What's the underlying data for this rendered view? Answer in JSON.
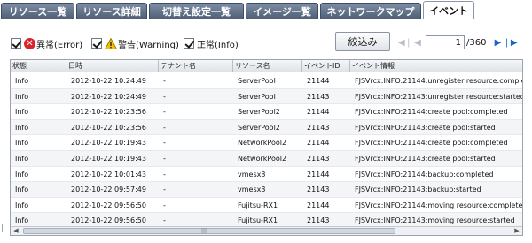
{
  "tabs": [
    {
      "label": "リソース一覧"
    },
    {
      "label": "リソース詳細"
    },
    {
      "label": "切替え設定一覧"
    },
    {
      "label": "イメージ一覧"
    },
    {
      "label": "ネットワークマップ"
    },
    {
      "label": "イベント"
    }
  ],
  "filters": {
    "error": {
      "label": "異常(Error)",
      "checked": true,
      "icon": "error-circle-icon",
      "color": "#d8242a"
    },
    "warning": {
      "label": "警告(Warning)",
      "checked": true,
      "icon": "warning-triangle-icon",
      "color": "#f2c200"
    },
    "info": {
      "label": "正常(Info)",
      "checked": true
    }
  },
  "filter_button": {
    "label": "絞込み"
  },
  "pager": {
    "current_page": "1",
    "total_pages": "/360"
  },
  "table": {
    "columns": [
      "状態",
      "日時",
      "テナント名",
      "リソース名",
      "イベントID",
      "イベント情報"
    ],
    "rows": [
      [
        "Info",
        "2012-10-22 10:24:49",
        "-",
        "ServerPool",
        "21144",
        "FJSVrcx:INFO:21144:unregister resource:completed"
      ],
      [
        "Info",
        "2012-10-22 10:24:49",
        "-",
        "ServerPool",
        "21143",
        "FJSVrcx:INFO:21143:unregister resource:started"
      ],
      [
        "Info",
        "2012-10-22 10:23:56",
        "-",
        "ServerPool2",
        "21144",
        "FJSVrcx:INFO:21144:create pool:completed"
      ],
      [
        "Info",
        "2012-10-22 10:23:56",
        "-",
        "ServerPool2",
        "21143",
        "FJSVrcx:INFO:21143:create pool:started"
      ],
      [
        "Info",
        "2012-10-22 10:19:43",
        "-",
        "NetworkPool2",
        "21144",
        "FJSVrcx:INFO:21144:create pool:completed"
      ],
      [
        "Info",
        "2012-10-22 10:19:43",
        "-",
        "NetworkPool2",
        "21143",
        "FJSVrcx:INFO:21143:create pool:started"
      ],
      [
        "Info",
        "2012-10-22 10:01:43",
        "-",
        "vmesx3",
        "21144",
        "FJSVrcx:INFO:21144:backup:completed"
      ],
      [
        "Info",
        "2012-10-22 09:57:49",
        "-",
        "vmesx3",
        "21143",
        "FJSVrcx:INFO:21143:backup:started"
      ],
      [
        "Info",
        "2012-10-22 09:56:50",
        "-",
        "Fujitsu-RX1",
        "21144",
        "FJSVrcx:INFO:21144:moving resource:completed"
      ],
      [
        "Info",
        "2012-10-22 09:56:50",
        "-",
        "Fujitsu-RX1",
        "21143",
        "FJSVrcx:INFO:21143:moving resource:started"
      ]
    ]
  },
  "scrollbar": {
    "grip": "|||"
  }
}
